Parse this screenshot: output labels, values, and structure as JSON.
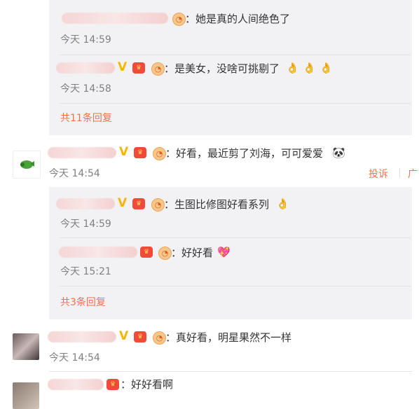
{
  "thread1": {
    "replies": [
      {
        "text": "：她是真的人间绝色了",
        "time": "今天 14:59"
      },
      {
        "text": "：是美女，没啥可挑剔了",
        "time": "今天 14:58"
      }
    ],
    "more": "共11条回复"
  },
  "comment2": {
    "text": "：好看，最近剪了刘海，可可爱爱",
    "time": "今天 14:54",
    "report": "投诉",
    "replies": [
      {
        "text": "：生图比修图好看系列",
        "time": "今天 14:59"
      },
      {
        "text": "：好好看",
        "time": "今天 15:21"
      }
    ],
    "more": "共3条回复"
  },
  "comment3": {
    "text": "：真好看，明星果然不一样",
    "time": "今天 14:54"
  },
  "comment4": {
    "text": "：好好看啊"
  },
  "icons": {
    "vip": "V",
    "ok_hand": "👌",
    "panda": "🐼",
    "heart": "💖",
    "crown": "👑"
  },
  "colors": {
    "accent": "#eb7350",
    "time": "#808080",
    "reply_bg": "#f2f2f5"
  }
}
